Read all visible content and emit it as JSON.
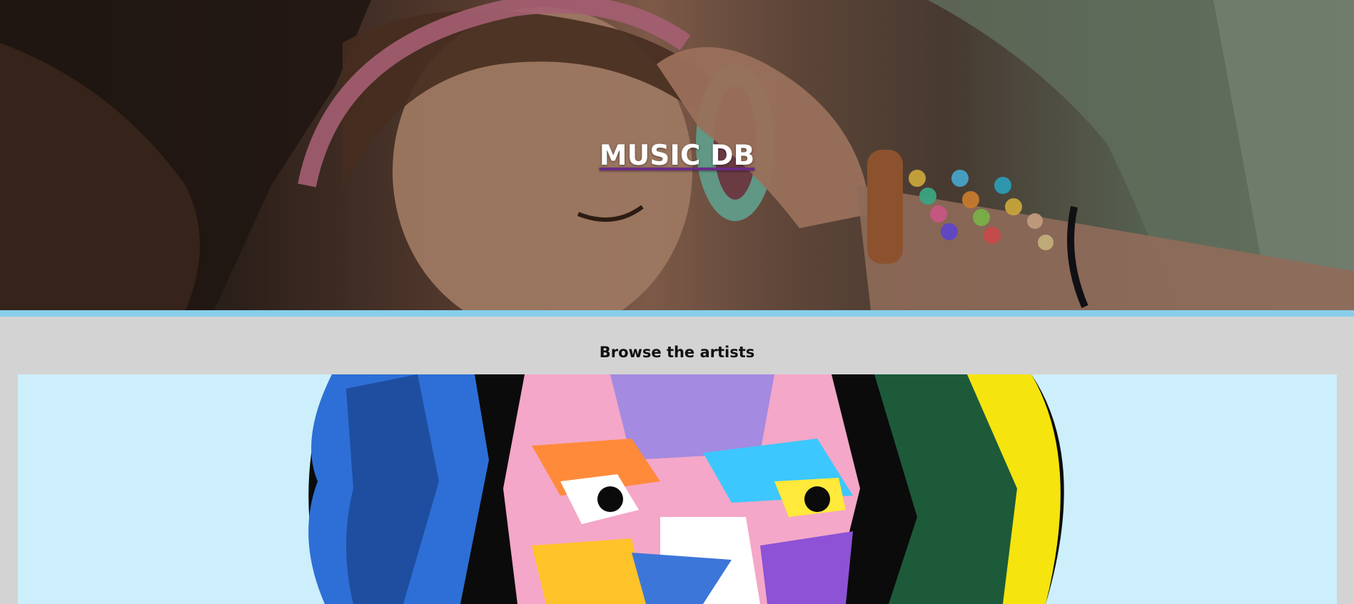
{
  "header": {
    "site_title": "MUSIC DB",
    "hero_image": "person-with-headphones-photo",
    "border_color": "#87ceeb",
    "title_underline_color": "#6a2c86"
  },
  "browse": {
    "heading": "Browse the artists",
    "card_background": "#cdeefb",
    "featured_artist_image": "colorful-pop-art-portrait"
  },
  "colors": {
    "page_background": "#d3d3d3",
    "title_text": "#ffffff"
  }
}
